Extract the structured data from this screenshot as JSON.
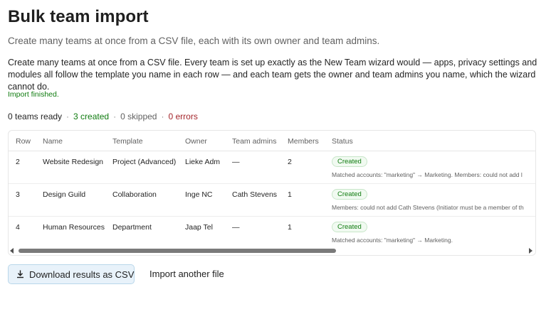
{
  "page": {
    "title": "Bulk team import",
    "subtitle": "Create many teams at once from a CSV file, each with its own owner and team admins.",
    "description": "Create many teams at once from a CSV file. Every team is set up exactly as the New Team wizard would — apps, privacy settings and modules all follow the template you name in each row — and each team gets the owner and team admins you name, which the wizard cannot do.",
    "status_message": "Import finished."
  },
  "summary": {
    "ready": "0 teams ready",
    "separator": "·",
    "created": "3 created",
    "skipped": "0 skipped",
    "errors": "0 errors"
  },
  "table": {
    "headers": {
      "row": "Row",
      "name": "Name",
      "template": "Template",
      "owner": "Owner",
      "admins": "Team admins",
      "members": "Members",
      "status": "Status"
    },
    "rows": [
      {
        "row": "2",
        "name": "Website Redesign",
        "template": "Project (Advanced)",
        "owner": "Lieke Adm",
        "admins": "—",
        "members": "2",
        "status": "Created",
        "note": "Matched accounts: \"marketing\" → Marketing. Members: could not add l"
      },
      {
        "row": "3",
        "name": "Design Guild",
        "template": "Collaboration",
        "owner": "Inge NC",
        "admins": "Cath Stevens",
        "members": "1",
        "status": "Created",
        "note": "Members: could not add Cath Stevens (Initiator must be a member of th"
      },
      {
        "row": "4",
        "name": "Human Resources",
        "template": "Department",
        "owner": "Jaap Tel",
        "admins": "—",
        "members": "1",
        "status": "Created",
        "note": "Matched accounts: \"marketing\" → Marketing."
      }
    ]
  },
  "actions": {
    "download_label": "Download results as CSV",
    "download_icon": "download-icon",
    "import_another_label": "Import another file"
  },
  "colors": {
    "success": "#107c10",
    "error": "#a4262c",
    "button_bg": "#e8f2fa"
  }
}
